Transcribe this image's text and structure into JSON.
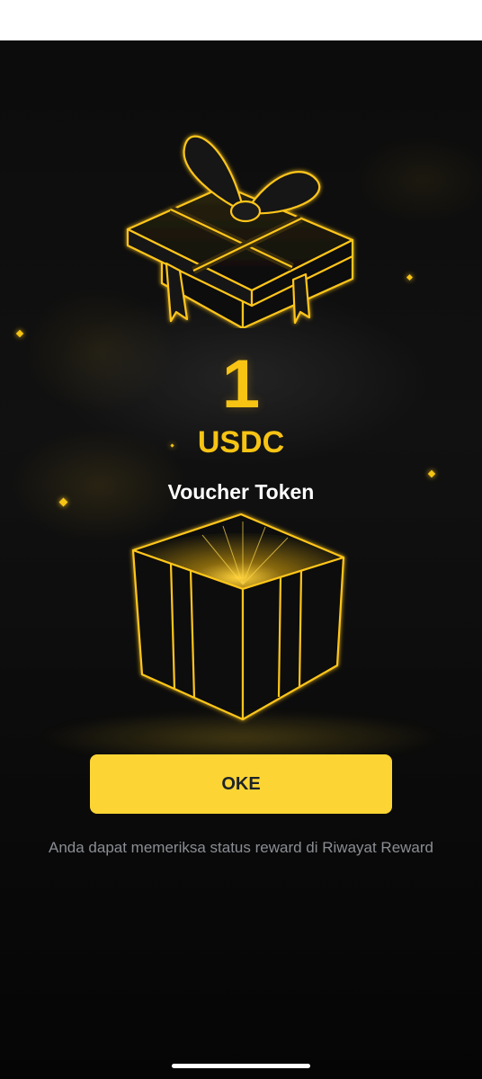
{
  "reward": {
    "amount": "1",
    "currency": "USDC",
    "type_label": "Voucher Token"
  },
  "actions": {
    "ok_label": "OKE"
  },
  "footer": {
    "hint_text": "Anda dapat memeriksa status reward di Riwayat Reward"
  },
  "icons": {
    "top": "gift-box-icon",
    "bottom": "open-box-icon"
  },
  "colors": {
    "accent": "#f7c414",
    "button": "#fcd535",
    "background": "#0b0b0b",
    "hint": "#8a8d93"
  }
}
